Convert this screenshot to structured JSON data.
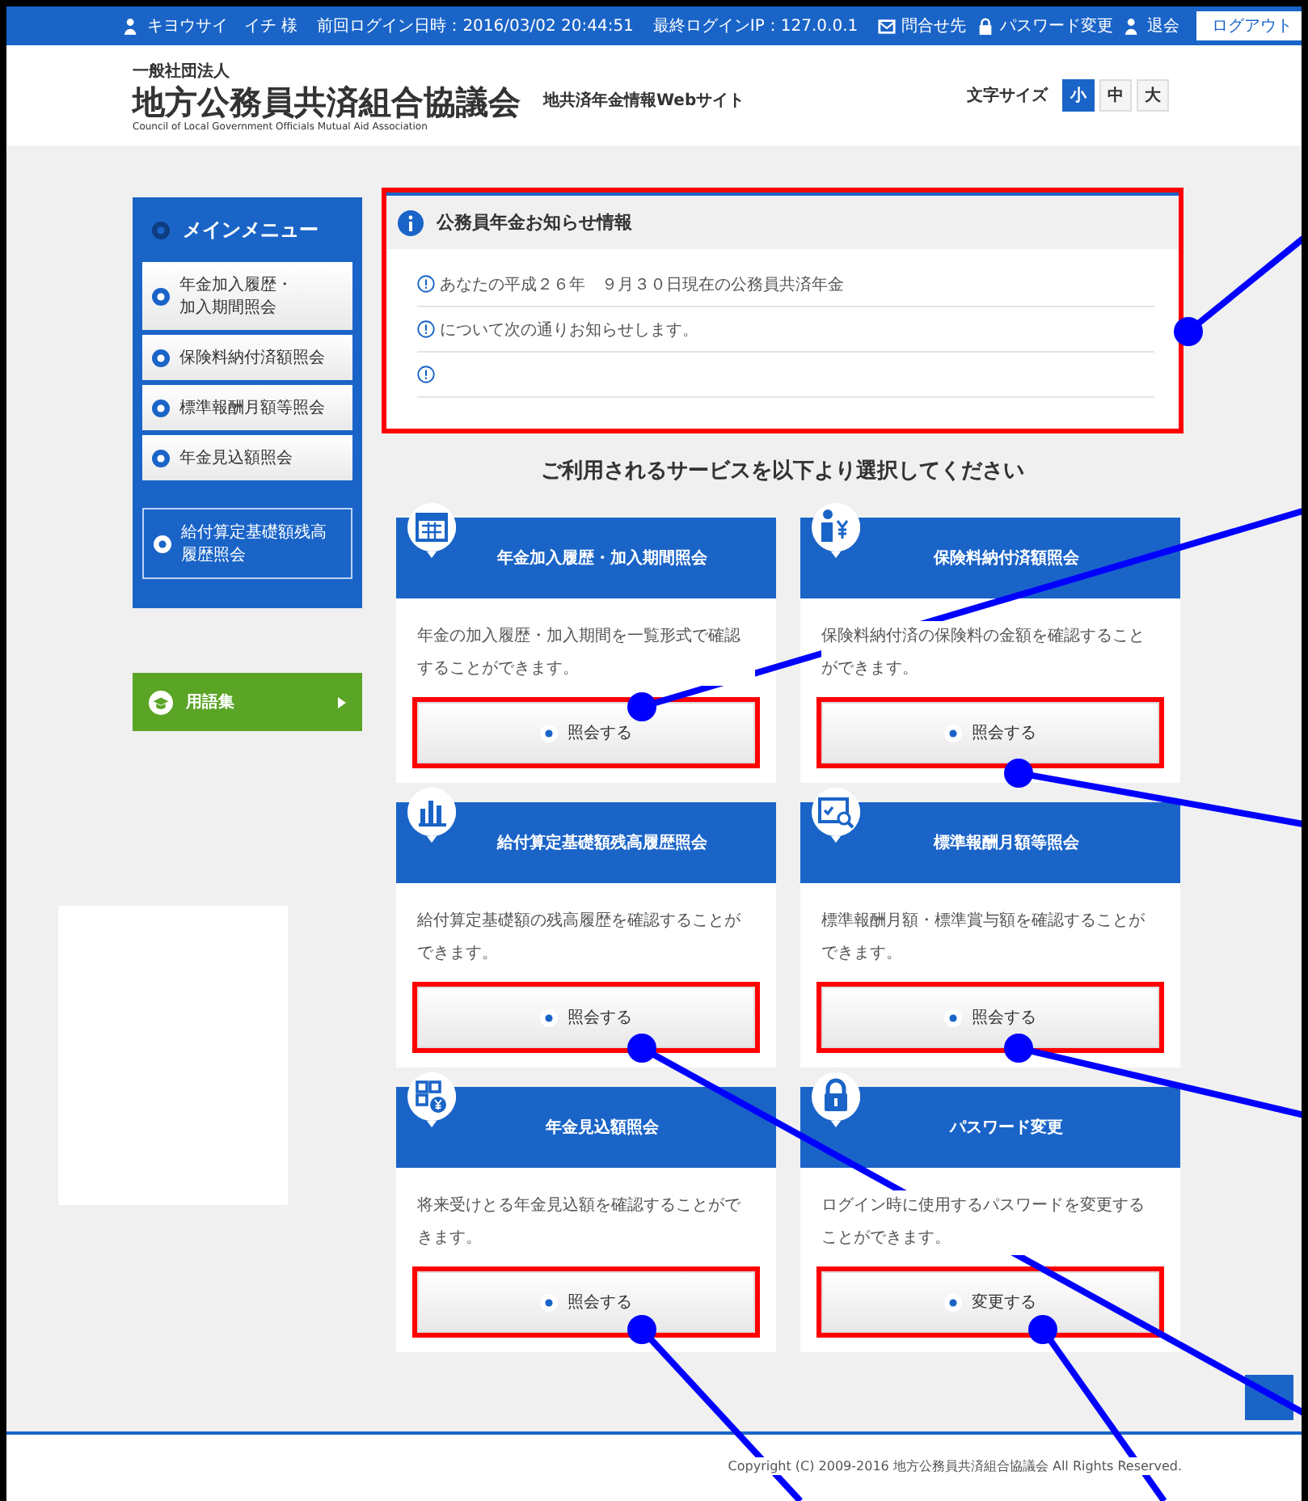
{
  "top_bar": {
    "user_name": "キヨウサイ　イチ 様",
    "last_login": "前回ログイン日時：2016/03/02 20:44:51",
    "last_ip": "最終ログインIP：127.0.0.1",
    "links": [
      {
        "label": "問合せ先"
      },
      {
        "label": "パスワード変更"
      },
      {
        "label": "退会"
      }
    ],
    "logout": "ログアウト"
  },
  "header": {
    "org_type": "一般社団法人",
    "org_name": "地方公務員共済組合協議会",
    "org_name_en": "Council of Local Government Officials Mutual Aid Association",
    "site_name": "地共済年金情報Webサイト",
    "font_size_label": "文字サイズ",
    "font_sizes": [
      {
        "label": "小",
        "selected": true
      },
      {
        "label": "中",
        "selected": false
      },
      {
        "label": "大",
        "selected": false
      }
    ]
  },
  "sidebar": {
    "title": "メインメニュー",
    "items": [
      {
        "lines": [
          "年金加入履歴・",
          "加入期間照会"
        ],
        "kind": "plain"
      },
      {
        "lines": [
          "保険料納付済額照会"
        ],
        "kind": "plain"
      },
      {
        "lines": [
          "標準報酬月額等照会"
        ],
        "kind": "plain"
      },
      {
        "lines": [
          "年金見込額照会"
        ],
        "kind": "plain"
      },
      {
        "lines": [
          "給付算定基礎額残高",
          "履歴照会"
        ],
        "kind": "boxed"
      }
    ],
    "glossary": "用語集"
  },
  "notice": {
    "title": "公務員年金お知らせ情報",
    "highlighted": true,
    "rows": [
      {
        "kind": "message",
        "text": "あなたの平成２６年　９月３０日現在の公務員共済年金"
      },
      {
        "kind": "message",
        "text": "について次の通りお知らせします。"
      },
      {
        "kind": "blank"
      }
    ]
  },
  "services_heading": "ご利用されるサービスを以下より選択してください",
  "services": [
    {
      "title": "年金加入履歴・加入期間照会",
      "description": "年金の加入履歴・加入期間を一覧形式で確認することができます。",
      "button": "照会する",
      "highlighted": true
    },
    {
      "title": "保険料納付済額照会",
      "description": "保険料納付済の保険料の金額を確認することができます。",
      "button": "照会する",
      "highlighted": true
    },
    {
      "title": "給付算定基礎額残高履歴照会",
      "description": "給付算定基礎額の残高履歴を確認することができます。",
      "button": "照会する",
      "highlighted": true
    },
    {
      "title": "標準報酬月額等照会",
      "description": "標準報酬月額・標準賞与額を確認することができます。",
      "button": "照会する",
      "highlighted": true
    },
    {
      "title": "年金見込額照会",
      "description": "将来受けとる年金見込額を確認することができます。",
      "button": "照会する",
      "highlighted": true
    },
    {
      "title": "パスワード変更",
      "description": "ログイン時に使用するパスワードを変更することができます。",
      "button": "変更する",
      "highlighted": true
    }
  ],
  "footer": {
    "copyright": "Copyright (C) 2009-2016 地方公務員共済組合協議会  All Rights Reserved."
  }
}
